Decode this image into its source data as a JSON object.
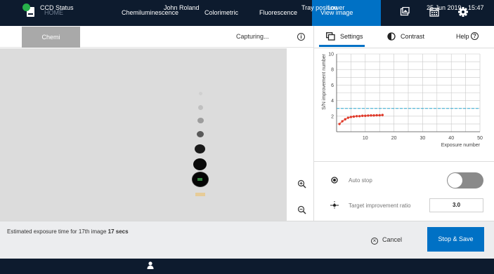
{
  "nav": {
    "home_label": "HOME",
    "items": [
      "Chemiluminescence",
      "Colorimetric",
      "Fluorescence",
      "View image"
    ],
    "active": "View image",
    "icons": [
      "gallery-icon",
      "calendar-icon",
      "gear-icon"
    ]
  },
  "subheader": {
    "tab_label": "Chemi",
    "capturing_label": "Capturing...",
    "info_icon": "info-icon"
  },
  "right_tabs": {
    "settings_label": "Settings",
    "contrast_label": "Contrast",
    "help_label": "Help"
  },
  "chart_data": {
    "type": "line",
    "xlabel": "Exposure number",
    "ylabel": "S/N improvement number",
    "xlim": [
      0,
      50
    ],
    "ylim": [
      0,
      10
    ],
    "xticks": [
      10,
      20,
      30,
      40,
      50
    ],
    "yticks": [
      2,
      4,
      6,
      8,
      10
    ],
    "grid": true,
    "threshold": 3.0,
    "threshold_color": "#2ba8d0",
    "series_color": "#e03a2a",
    "x": [
      1,
      2,
      3,
      4,
      5,
      6,
      7,
      8,
      9,
      10,
      11,
      12,
      13,
      14,
      15,
      16
    ],
    "y": [
      1.0,
      1.35,
      1.6,
      1.8,
      1.9,
      1.95,
      2.0,
      2.0,
      2.05,
      2.05,
      2.08,
      2.1,
      2.1,
      2.12,
      2.12,
      2.15
    ]
  },
  "options": {
    "auto_stop_label": "Auto stop",
    "auto_stop_on": false,
    "target_label": "Target improvement ratio",
    "target_value": "3.0"
  },
  "footer": {
    "estimate_text": "Estimated exposure time for 17th image",
    "estimate_value": "17 secs",
    "cancel_label": "Cancel",
    "stop_save_label": "Stop & Save"
  },
  "status": {
    "ccd_label": "CCD Status",
    "user_name": "John Roland",
    "tray_label": "Tray position",
    "tray_value": "Lower",
    "date": "25 Jun 2019",
    "time": "15:47"
  },
  "colors": {
    "nav_bg": "#0d1b2e",
    "accent": "#0071c5",
    "status_ok": "#27b14a"
  }
}
